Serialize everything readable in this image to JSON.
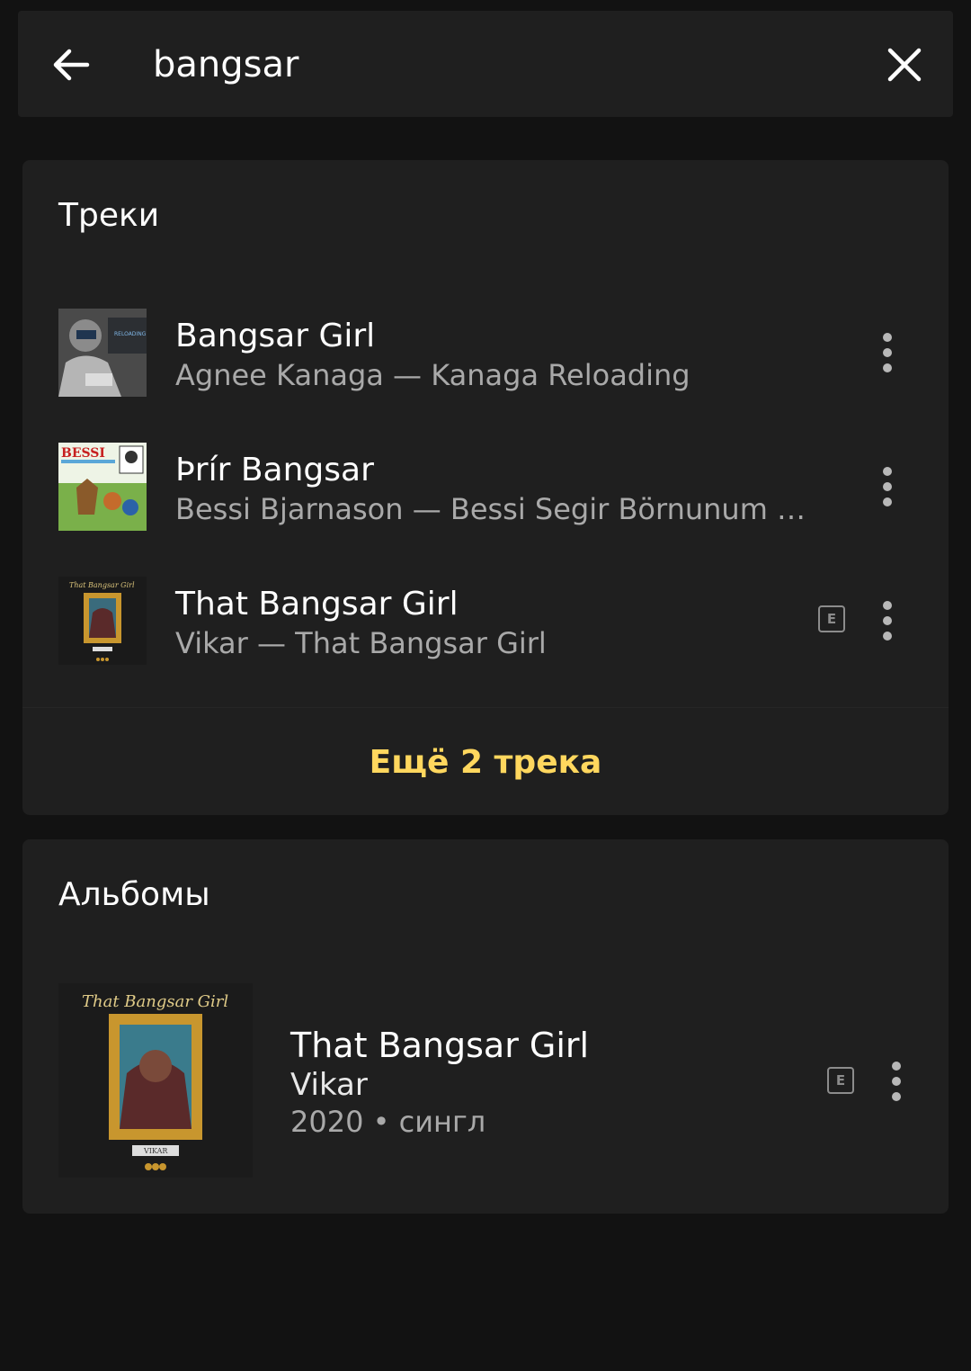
{
  "search": {
    "query": "bangsar"
  },
  "tracks_section": {
    "title": "Треки",
    "items": [
      {
        "title": "Bangsar Girl",
        "subtitle": "Agnee Kanaga — Kanaga Reloading",
        "explicit": false,
        "cover_text": "RELOADING"
      },
      {
        "title": "Þrír Bangsar",
        "subtitle": "Bessi Bjarnason — Bessi Segir Börnunum Sögur",
        "explicit": false,
        "cover_text": "BESSI"
      },
      {
        "title": "That Bangsar Girl",
        "subtitle": "Vikar — That Bangsar Girl",
        "explicit": true,
        "explicit_label": "E",
        "cover_text": "That Bangsar Girl"
      }
    ],
    "more_label": "Ещё 2 трека"
  },
  "albums_section": {
    "title": "Альбомы",
    "items": [
      {
        "title": "That Bangsar Girl",
        "artist": "Vikar",
        "meta": "2020 • сингл",
        "explicit": true,
        "explicit_label": "E",
        "cover_text": "That Bangsar Girl",
        "cover_label": "VIKAR"
      }
    ]
  },
  "colors": {
    "background": "#121212",
    "card": "#1f1f1f",
    "accent": "#ffd75e",
    "text_primary": "#ffffff",
    "text_secondary": "#a9a9a9"
  },
  "icons": {
    "back": "arrow-left-icon",
    "clear": "close-icon",
    "more": "more-vertical-icon",
    "explicit": "explicit-badge-icon"
  }
}
